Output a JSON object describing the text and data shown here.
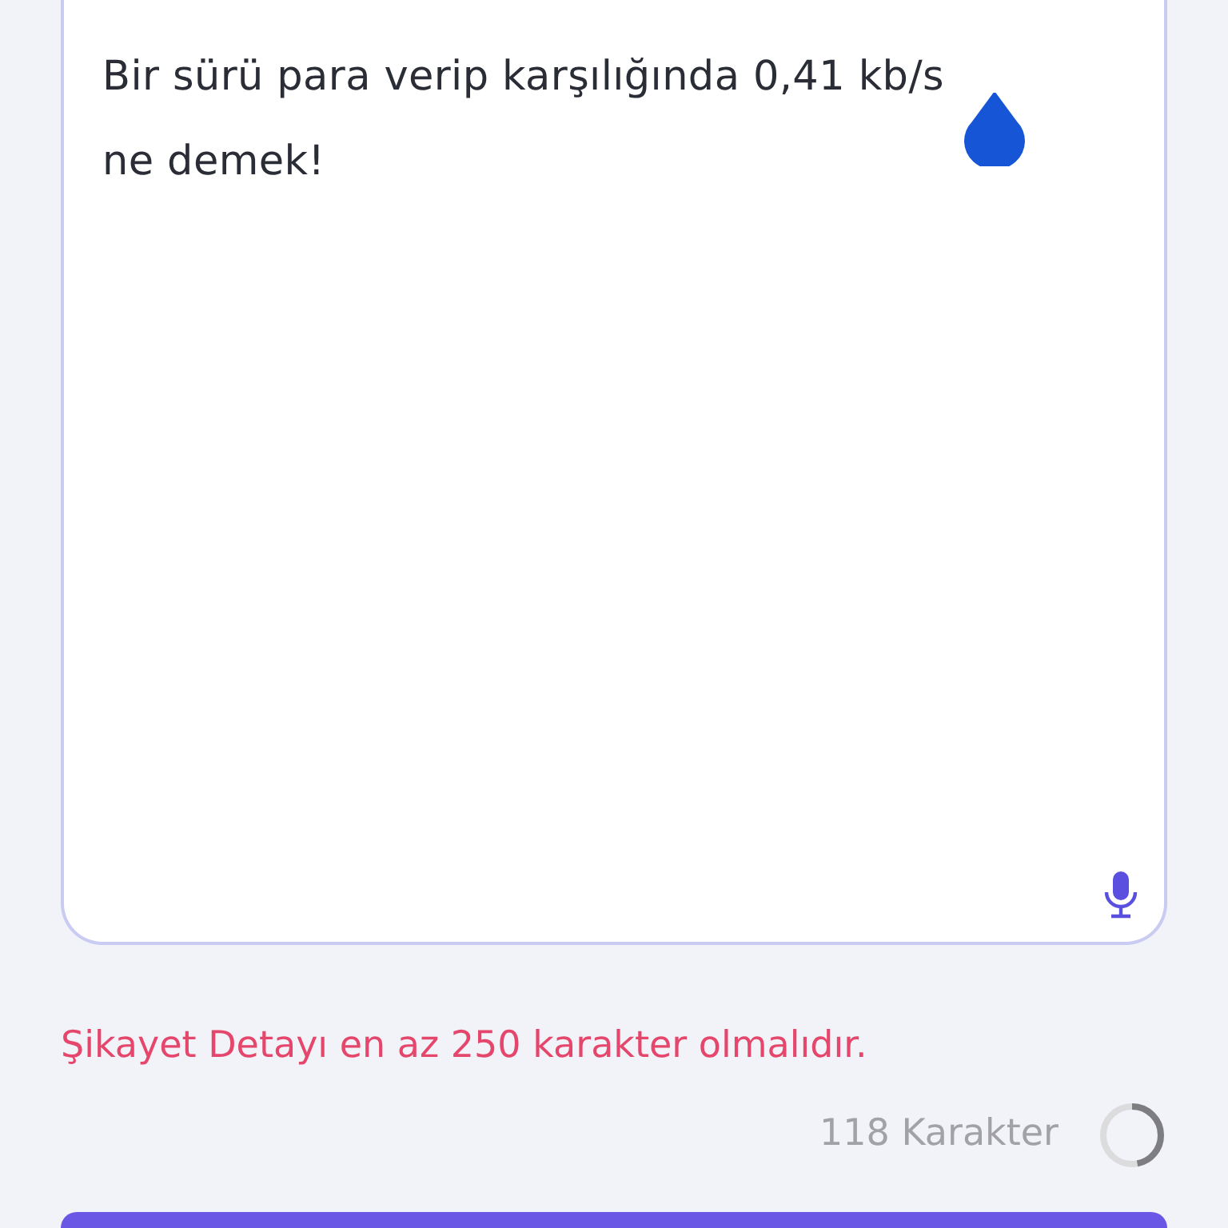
{
  "complaint_field": {
    "value": "Bir sürü para verip karşılığında 0,41 kb/s ne demek!"
  },
  "error_message": "Şikayet Detayı en az 250 karakter olmalıdır.",
  "character_count": {
    "text": "118 Karakter",
    "level": 0.47
  }
}
